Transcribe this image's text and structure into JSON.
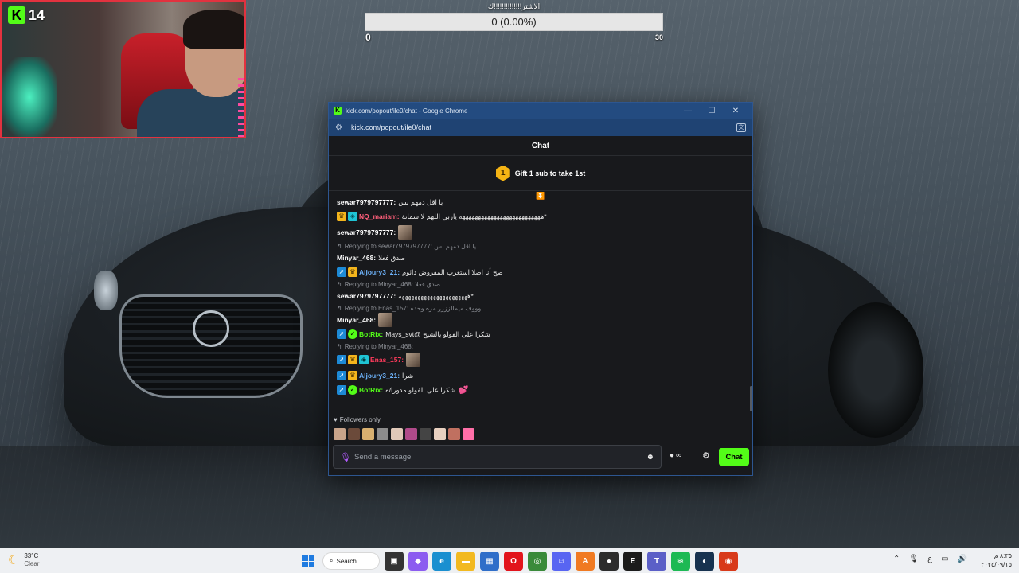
{
  "webcam": {
    "viewer_count": "14",
    "brand_letter": "K"
  },
  "goal": {
    "title": "الاشتر!!!!!!!!!!!!!!ك",
    "progress_text": "0 (0.00%)",
    "progress_fraction": 0.0,
    "min": "0",
    "max": "30"
  },
  "window": {
    "title": "kick.com/popout/ile0/chat - Google Chrome",
    "url": "kick.com/popout/ile0/chat",
    "controls": {
      "minimize": "—",
      "maximize": "☐",
      "close": "✕"
    }
  },
  "chat": {
    "header": "Chat",
    "pinned": {
      "rank": "1",
      "text": "Gift 1 sub to take 1st"
    },
    "messages": [
      {
        "type": "msg",
        "user": "sewar7979797777:",
        "color": "#ffffff",
        "badges": [],
        "text": "يا اقل دمهم بس"
      },
      {
        "type": "msg",
        "user": "NQ_mariam:",
        "color": "#ff5f7a",
        "badges": [
          "crown",
          "vip"
        ],
        "text": "*ههههههههههههههههههههههههههه ياربي اللهم لا شماتة"
      },
      {
        "type": "msg",
        "user": "sewar7979797777:",
        "color": "#ffffff",
        "badges": [],
        "text": "",
        "emote": true,
        "tall": true
      },
      {
        "type": "reply",
        "text": "Replying to sewar7979797777: يا اقل دمهم بس"
      },
      {
        "type": "msg",
        "user": "Minyar_468:",
        "color": "#ffffff",
        "badges": [],
        "text": "صدق فعلا"
      },
      {
        "type": "msg",
        "user": "Aljoury3_21:",
        "color": "#6fb6ff",
        "badges": [
          "arrow",
          "crown"
        ],
        "text": "صح أنا اصلا استغرب المفروض دائوم"
      },
      {
        "type": "reply",
        "text": "Replying to Minyar_468: صدق فعلا"
      },
      {
        "type": "msg",
        "user": "sewar7979797777:",
        "color": "#ffffff",
        "badges": [],
        "text": "*ههههههههههههههههههههههه"
      },
      {
        "type": "reply",
        "text": "Replying to Enas_157: اوووف ميمالزززر مره وحده"
      },
      {
        "type": "msg",
        "user": "Minyar_468:",
        "color": "#ffffff",
        "badges": [],
        "text": "",
        "emote": true
      },
      {
        "type": "msg",
        "user": "BotRix:",
        "color": "#53fc18",
        "badges": [
          "arrow",
          "verified"
        ],
        "text": "شكرا على الفولو يالشيخ @Mays_svt"
      },
      {
        "type": "reply",
        "text": "Replying to Minyar_468:"
      },
      {
        "type": "msg",
        "user": "Enas_157:",
        "color": "#ff3b5c",
        "badges": [
          "arrow",
          "crown",
          "vip"
        ],
        "text": "",
        "emote": true,
        "tall": true
      },
      {
        "type": "msg",
        "user": "Aljoury3_21:",
        "color": "#6fb6ff",
        "badges": [
          "arrow",
          "crown"
        ],
        "text": "شرا"
      },
      {
        "type": "msg",
        "user": "BotRix:",
        "color": "#53fc18",
        "badges": [
          "arrow",
          "verified"
        ],
        "text": "شكرا على الفولو مدورا/ه",
        "hearts": "💕"
      }
    ],
    "followers_only": "Followers only",
    "composer": {
      "placeholder": "Send a message"
    },
    "points_symbol": "∞",
    "send_label": "Chat"
  },
  "taskbar": {
    "weather": {
      "temp": "33°C",
      "desc": "Clear"
    },
    "search_label": "Search",
    "clock": {
      "time": "٨:٣٥ م",
      "date": "٢٠٢٥/٠٩/١٥"
    },
    "lang": "ع"
  }
}
